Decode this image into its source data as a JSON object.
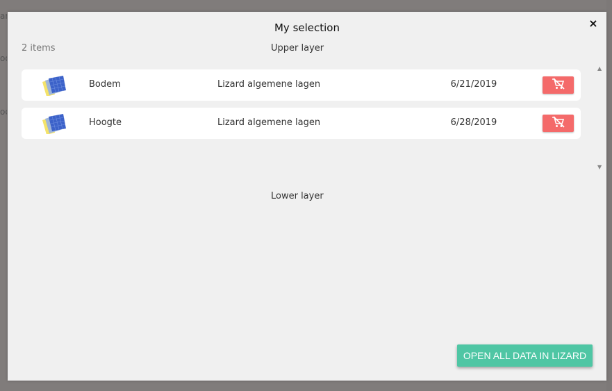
{
  "background": {
    "hint_1": "ar",
    "hint_2": "oo",
    "hint_3": "oc"
  },
  "modal": {
    "title": "My selection",
    "close_label": "×",
    "item_count": "2 items",
    "upper_layer_label": "Upper layer",
    "lower_layer_label": "Lower layer",
    "items": [
      {
        "name": "Bodem",
        "organisation": "Lizard algemene lagen",
        "date": "6/21/2019",
        "thumbnail_icon": "raster-layers-icon",
        "remove_icon": "remove-from-cart-icon"
      },
      {
        "name": "Hoogte",
        "organisation": "Lizard algemene lagen",
        "date": "6/28/2019",
        "thumbnail_icon": "raster-layers-icon",
        "remove_icon": "remove-from-cart-icon"
      }
    ],
    "open_all_button": "OPEN ALL DATA IN LIZARD"
  },
  "colors": {
    "remove_button": "#f46a6a",
    "open_button": "#4fc6a4",
    "modal_background": "#f0f0f0",
    "overlay": "#807c7b"
  }
}
